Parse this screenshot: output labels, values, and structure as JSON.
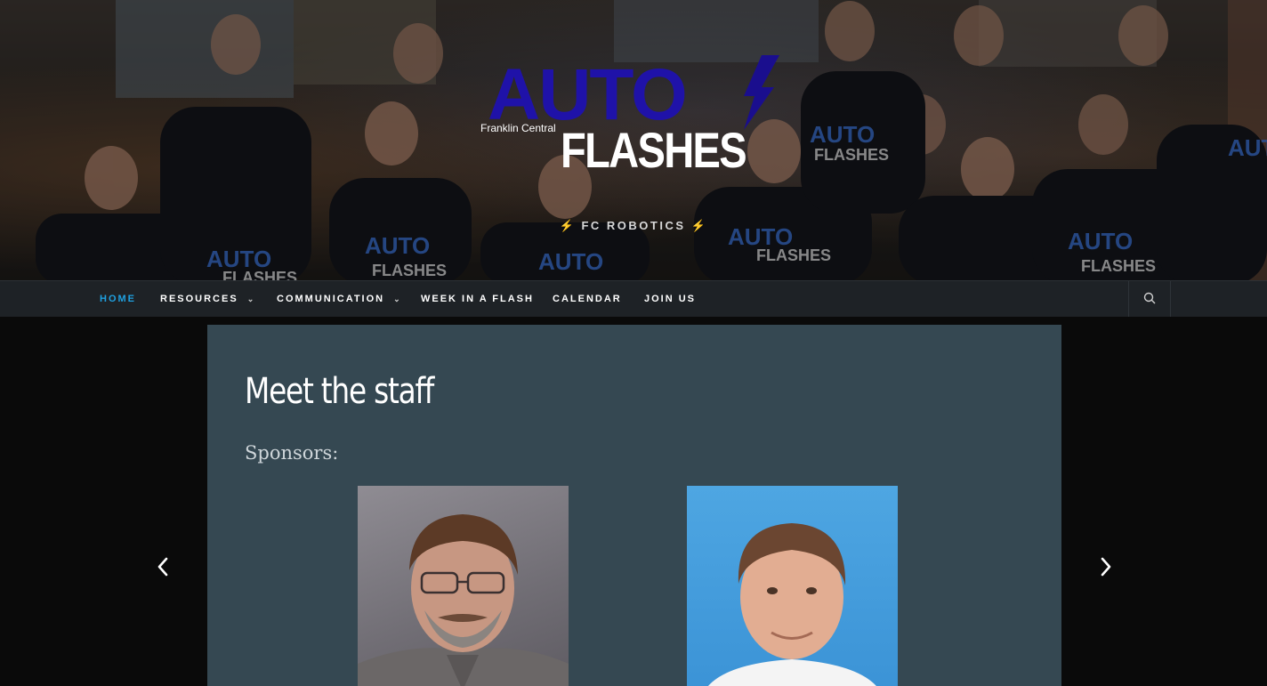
{
  "header": {
    "logo": {
      "line1": "AUTO",
      "line2": "FLASHES",
      "school": "Franklin Central",
      "bolt_color": "#1a0e8e",
      "auto_color": "#1f12a8"
    },
    "tagline": {
      "bolt_left": "⚡",
      "text": "FC ROBOTICS",
      "bolt_right": "⚡"
    }
  },
  "nav": {
    "items": [
      {
        "label": "HOME",
        "active": true
      },
      {
        "label": "RESOURCES",
        "has_dropdown": true
      },
      {
        "label": "COMMUNICATION",
        "has_dropdown": true
      },
      {
        "label": "WEEK IN A FLASH"
      },
      {
        "label": "CALENDAR"
      },
      {
        "label": "JOIN US"
      }
    ],
    "dropdown_glyph": "⌄",
    "search_icon": "search-icon",
    "active_color": "#1fa0e0"
  },
  "main": {
    "title": "Meet the staff",
    "section_heading": "Sponsors:",
    "photos": [
      {
        "icon": "sponsor-photo-1"
      },
      {
        "icon": "sponsor-photo-2"
      }
    ]
  },
  "slider": {
    "prev_icon": "chevron-left-icon",
    "next_icon": "chevron-right-icon"
  }
}
